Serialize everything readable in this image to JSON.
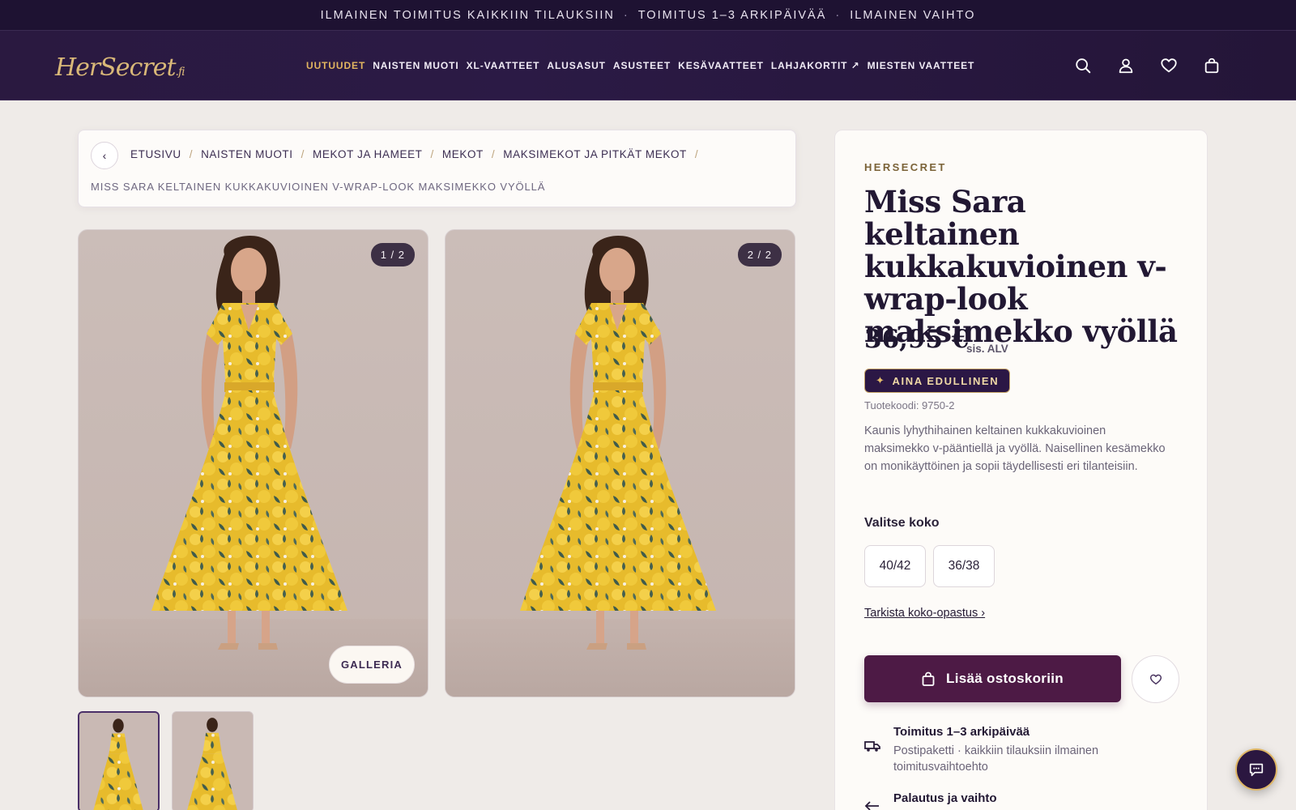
{
  "announcement": {
    "items": [
      "ILMAINEN TOIMITUS KAIKKIIN TILAUKSIIN",
      "TOIMITUS 1–3 ARKIPÄIVÄÄ",
      "ILMAINEN VAIHTO"
    ],
    "separator": "·"
  },
  "header": {
    "logo_main": "HerSecret",
    "logo_suffix": ".fi",
    "nav": [
      {
        "label": "UUTUUDET",
        "active": true
      },
      {
        "label": "NAISTEN MUOTI"
      },
      {
        "label": "XL-VAATTEET"
      },
      {
        "label": "ALUSASUT"
      },
      {
        "label": "ASUSTEET"
      },
      {
        "label": "KESÄVAATTEET"
      },
      {
        "label": "LAHJAKORTIT ↗"
      },
      {
        "label": "MIESTEN VAATTEET"
      }
    ],
    "icons": [
      "search-icon",
      "account-icon",
      "wishlist-icon",
      "cart-icon"
    ]
  },
  "breadcrumb": {
    "back_glyph": "‹",
    "items": [
      "ETUSIVU",
      "NAISTEN MUOTI",
      "MEKOT JA HAMEET",
      "MEKOT",
      "MAKSIMEKOT JA PITKÄT MEKOT"
    ],
    "separator": "/",
    "current": "MISS SARA KELTAINEN KUKKAKUVIOINEN V-WRAP-LOOK MAKSIMEKKO VYÖLLÄ"
  },
  "gallery": {
    "counter_1": "1 / 2",
    "counter_2": "2 / 2",
    "gallery_button": "GALLERIA"
  },
  "product": {
    "brand": "HERSECRET",
    "title": "Miss Sara keltainen kukkakuvioinen v-wrap-look maksimekko vyöllä",
    "price": "36,95 €",
    "vat": "sis. ALV",
    "badge": "AINA EDULLINEN",
    "badge_glyph": "✦",
    "sku": "Tuotekoodi: 9750-2",
    "description": "Kaunis lyhythihainen keltainen kukkakuvioinen maksimekko v-pääntiellä ja vyöllä. Naisellinen kesämekko on monikäyttöinen ja sopii täydellisesti eri tilanteisiin.",
    "size_label": "Valitse koko",
    "sizes": [
      "40/42",
      "36/38"
    ],
    "size_guide": "Tarkista koko-opastus ›",
    "add_to_cart": "Lisää ostoskoriin",
    "shipping_title": "Toimitus 1–3 arkipäivää",
    "shipping_text": "Postipaketti · kaikkiin tilauksiin ilmainen toimitusvaihtoehto",
    "returns_title": "Palautus ja vaihto"
  },
  "colors": {
    "brand_purple": "#2a1940",
    "gold": "#e2b560",
    "cart_button": "#4d1a45",
    "dress_yellow": "#e3b52a"
  }
}
